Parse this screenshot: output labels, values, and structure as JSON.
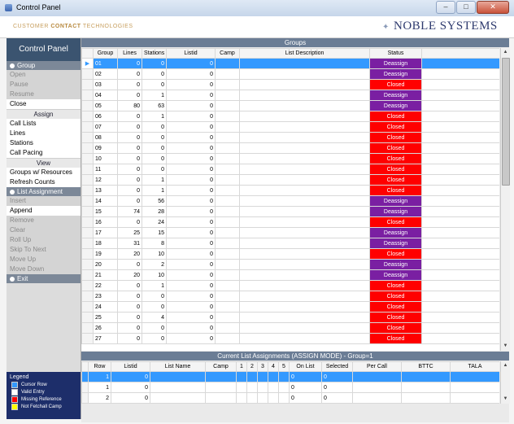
{
  "window": {
    "title": "Control Panel",
    "min": "–",
    "max": "□",
    "close": "✕"
  },
  "header": {
    "brand_left_1": "CUSTOMER ",
    "brand_left_2": "CONTACT",
    "brand_left_3": " TECHNOLOGIES",
    "brand_right": "NOBLE SYSTEMS"
  },
  "sidebar": {
    "title": "Control Panel",
    "group_section": "Group",
    "group_items": [
      {
        "label": "Open",
        "enabled": false
      },
      {
        "label": "Pause",
        "enabled": false
      },
      {
        "label": "Resume",
        "enabled": false
      },
      {
        "label": "Close",
        "enabled": true
      }
    ],
    "assign_header": "Assign",
    "assign_items": [
      "Call Lists",
      "Lines",
      "Stations",
      "Call Pacing"
    ],
    "view_header": "View",
    "view_items": [
      "Groups w/ Resources",
      "Refresh Counts"
    ],
    "list_section": "List Assignment",
    "list_items": [
      {
        "label": "Insert",
        "enabled": false
      },
      {
        "label": "Append",
        "enabled": true
      },
      {
        "label": "Remove",
        "enabled": false
      },
      {
        "label": "Clear",
        "enabled": false
      },
      {
        "label": "Roll Up",
        "enabled": false
      },
      {
        "label": "Skip To Next",
        "enabled": false
      },
      {
        "label": "Move Up",
        "enabled": false
      },
      {
        "label": "Move Down",
        "enabled": false
      }
    ],
    "exit_section": "Exit",
    "legend": {
      "title": "Legend",
      "items": [
        {
          "label": "Cursor Row",
          "color": "#3399ff"
        },
        {
          "label": "Valid Entry",
          "color": "#ffffff"
        },
        {
          "label": "Missing Reference",
          "color": "#ff0000"
        },
        {
          "label": "Not Fetchall Camp",
          "color": "#ffff00"
        }
      ]
    }
  },
  "groups": {
    "title": "Groups",
    "columns": [
      "Group",
      "Lines",
      "Stations",
      "Listid",
      "Camp",
      "List Description",
      "Status"
    ],
    "rows": [
      [
        "01",
        "0",
        "0",
        "0",
        "",
        "",
        "Deassign"
      ],
      [
        "02",
        "0",
        "0",
        "0",
        "",
        "",
        "Deassign"
      ],
      [
        "03",
        "0",
        "0",
        "0",
        "",
        "",
        "Closed"
      ],
      [
        "04",
        "0",
        "1",
        "0",
        "",
        "",
        "Deassign"
      ],
      [
        "05",
        "80",
        "63",
        "0",
        "",
        "",
        "Deassign"
      ],
      [
        "06",
        "0",
        "1",
        "0",
        "",
        "",
        "Closed"
      ],
      [
        "07",
        "0",
        "0",
        "0",
        "",
        "",
        "Closed"
      ],
      [
        "08",
        "0",
        "0",
        "0",
        "",
        "",
        "Closed"
      ],
      [
        "09",
        "0",
        "0",
        "0",
        "",
        "",
        "Closed"
      ],
      [
        "10",
        "0",
        "0",
        "0",
        "",
        "",
        "Closed"
      ],
      [
        "11",
        "0",
        "0",
        "0",
        "",
        "",
        "Closed"
      ],
      [
        "12",
        "0",
        "1",
        "0",
        "",
        "",
        "Closed"
      ],
      [
        "13",
        "0",
        "1",
        "0",
        "",
        "",
        "Closed"
      ],
      [
        "14",
        "0",
        "56",
        "0",
        "",
        "",
        "Deassign"
      ],
      [
        "15",
        "74",
        "28",
        "0",
        "",
        "",
        "Deassign"
      ],
      [
        "16",
        "0",
        "24",
        "0",
        "",
        "",
        "Closed"
      ],
      [
        "17",
        "25",
        "15",
        "0",
        "",
        "",
        "Deassign"
      ],
      [
        "18",
        "31",
        "8",
        "0",
        "",
        "",
        "Deassign"
      ],
      [
        "19",
        "20",
        "10",
        "0",
        "",
        "",
        "Closed"
      ],
      [
        "20",
        "0",
        "2",
        "0",
        "",
        "",
        "Deassign"
      ],
      [
        "21",
        "20",
        "10",
        "0",
        "",
        "",
        "Deassign"
      ],
      [
        "22",
        "0",
        "1",
        "0",
        "",
        "",
        "Closed"
      ],
      [
        "23",
        "0",
        "0",
        "0",
        "",
        "",
        "Closed"
      ],
      [
        "24",
        "0",
        "0",
        "0",
        "",
        "",
        "Closed"
      ],
      [
        "25",
        "0",
        "4",
        "0",
        "",
        "",
        "Closed"
      ],
      [
        "26",
        "0",
        "0",
        "0",
        "",
        "",
        "Closed"
      ],
      [
        "27",
        "0",
        "0",
        "0",
        "",
        "",
        "Closed"
      ]
    ],
    "selected_row": 0,
    "status_colors": {
      "Deassign": "#7a1fa2",
      "Closed": "#ff0000"
    }
  },
  "assignments": {
    "title": "Current List Assignments (ASSIGN MODE) - Group=1",
    "columns": [
      "Row",
      "Listid",
      "List Name",
      "Camp",
      "1",
      "2",
      "3",
      "4",
      "5",
      "On List",
      "Selected",
      "Per Call",
      "BTTC",
      "TALA"
    ],
    "rows": [
      [
        "1",
        "0",
        "",
        "",
        "",
        "",
        "",
        "",
        "",
        "0",
        "0",
        "",
        "",
        ""
      ],
      [
        "1",
        "0",
        "",
        "",
        "",
        "",
        "",
        "",
        "",
        "0",
        "0",
        "",
        "",
        ""
      ],
      [
        "2",
        "0",
        "",
        "",
        "",
        "",
        "",
        "",
        "",
        "0",
        "0",
        "",
        "",
        ""
      ]
    ],
    "selected_row": 0
  }
}
